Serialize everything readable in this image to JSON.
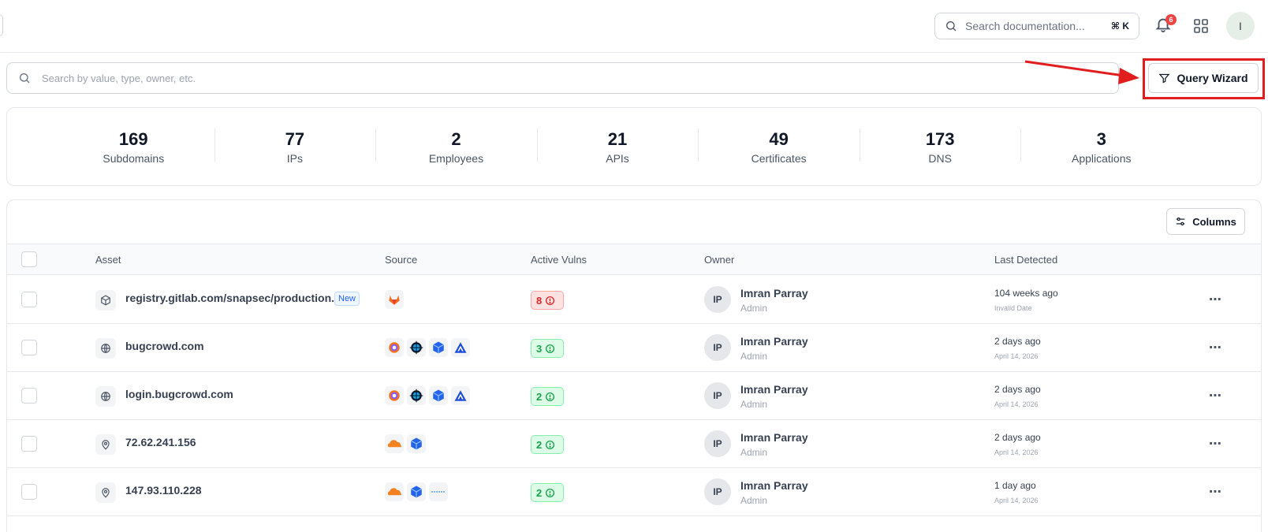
{
  "header": {
    "doc_search_placeholder": "Search documentation...",
    "doc_search_shortcut": "⌘ K",
    "notification_count": "6",
    "user_initial": "I"
  },
  "search": {
    "placeholder": "Search by value, type, owner, etc.",
    "query_wizard_label": "Query Wizard"
  },
  "stats": [
    {
      "value": "169",
      "label": "Subdomains"
    },
    {
      "value": "77",
      "label": "IPs"
    },
    {
      "value": "2",
      "label": "Employees"
    },
    {
      "value": "21",
      "label": "APIs"
    },
    {
      "value": "49",
      "label": "Certificates"
    },
    {
      "value": "173",
      "label": "DNS"
    },
    {
      "value": "3",
      "label": "Applications"
    }
  ],
  "table": {
    "columns_button": "Columns",
    "headers": {
      "asset": "Asset",
      "source": "Source",
      "active_vulns": "Active Vulns",
      "owner": "Owner",
      "last_detected": "Last Detected"
    },
    "rows": [
      {
        "asset": "registry.gitlab.com/snapsec/production...",
        "asset_icon": "container-icon",
        "badge": "New",
        "sources": [
          "gitlab-icon"
        ],
        "vulns": "8",
        "vuln_color": "#dc2626",
        "owner_initials": "IP",
        "owner_name": "Imran Parray",
        "owner_role": "Admin",
        "detected": "104 weeks ago",
        "detected_sub": "Invalid Date"
      },
      {
        "asset": "bugcrowd.com",
        "asset_icon": "globe-icon",
        "sources": [
          "target-icon",
          "crosshair-globe-icon",
          "cube-icon",
          "mountain-icon"
        ],
        "vulns": "3",
        "vuln_color": "#16a34a",
        "owner_initials": "IP",
        "owner_name": "Imran Parray",
        "owner_role": "Admin",
        "detected": "2 days ago",
        "detected_sub": "April 14, 2026"
      },
      {
        "asset": "login.bugcrowd.com",
        "asset_icon": "globe-icon",
        "sources": [
          "target-icon",
          "crosshair-globe-icon",
          "cube-icon",
          "mountain-icon"
        ],
        "vulns": "2",
        "vuln_color": "#16a34a",
        "owner_initials": "IP",
        "owner_name": "Imran Parray",
        "owner_role": "Admin",
        "detected": "2 days ago",
        "detected_sub": "April 14, 2026"
      },
      {
        "asset": "72.62.241.156",
        "asset_icon": "location-pin-icon",
        "sources": [
          "cloudflare-icon",
          "cube-icon"
        ],
        "vulns": "2",
        "vuln_color": "#16a34a",
        "owner_initials": "IP",
        "owner_name": "Imran Parray",
        "owner_role": "Admin",
        "detected": "2 days ago",
        "detected_sub": "April 14, 2026"
      },
      {
        "asset": "147.93.110.228",
        "asset_icon": "location-pin-icon",
        "sources": [
          "cloudflare-icon",
          "cube-icon",
          "dots-line-icon"
        ],
        "vulns": "2",
        "vuln_color": "#16a34a",
        "owner_initials": "IP",
        "owner_name": "Imran Parray",
        "owner_role": "Admin",
        "detected": "1 day ago",
        "detected_sub": "April 14, 2026"
      }
    ]
  }
}
